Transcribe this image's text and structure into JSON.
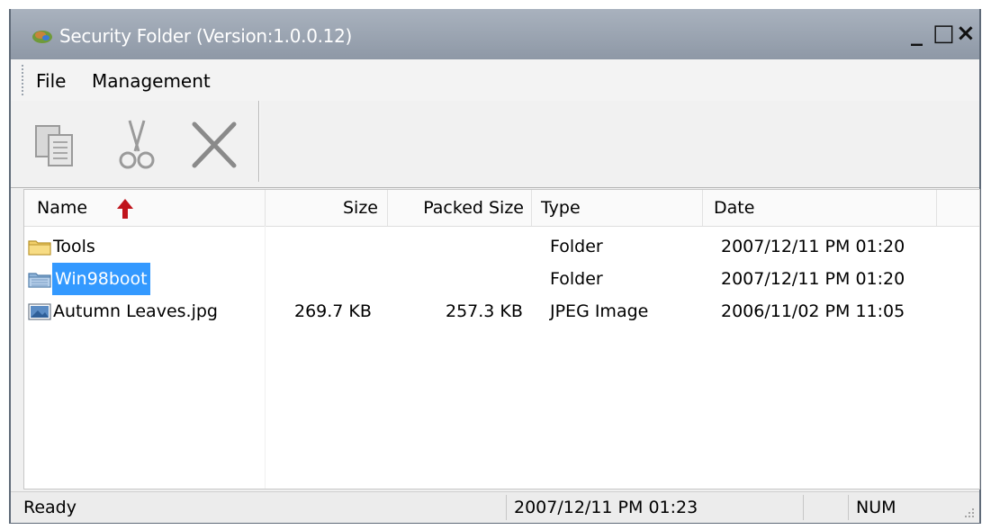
{
  "window": {
    "title": "Security Folder (Version:1.0.0.12)",
    "minimize_glyph": "_",
    "maximize_glyph": "□",
    "close_glyph": "×"
  },
  "menu": {
    "items": [
      "File",
      "Management"
    ]
  },
  "toolbar": {
    "buttons": [
      "copy-icon",
      "cut-icon",
      "delete-icon"
    ]
  },
  "list": {
    "columns": [
      "Name",
      "Size",
      "Packed Size",
      "Type",
      "Date"
    ],
    "sort": {
      "column": "Name",
      "direction": "ascending",
      "arrow_color": "#c0141c"
    },
    "rows": [
      {
        "icon": "folder-icon",
        "name": "Tools",
        "size": "",
        "packed": "",
        "type": "Folder",
        "date": "2007/12/11 PM 01:20",
        "selected": false
      },
      {
        "icon": "folder-special-icon",
        "name": "Win98boot",
        "size": "",
        "packed": "",
        "type": "Folder",
        "date": "2007/12/11 PM 01:20",
        "selected": true
      },
      {
        "icon": "image-file-icon",
        "name": "Autumn Leaves.jpg",
        "size": "269.7 KB",
        "packed": "257.3 KB",
        "type": "JPEG Image",
        "date": "2006/11/02 PM 11:05",
        "selected": false
      }
    ],
    "selection_color": "#3399ff"
  },
  "status": {
    "text": "Ready",
    "datetime": "2007/12/11 PM 01:23",
    "num": "NUM"
  }
}
